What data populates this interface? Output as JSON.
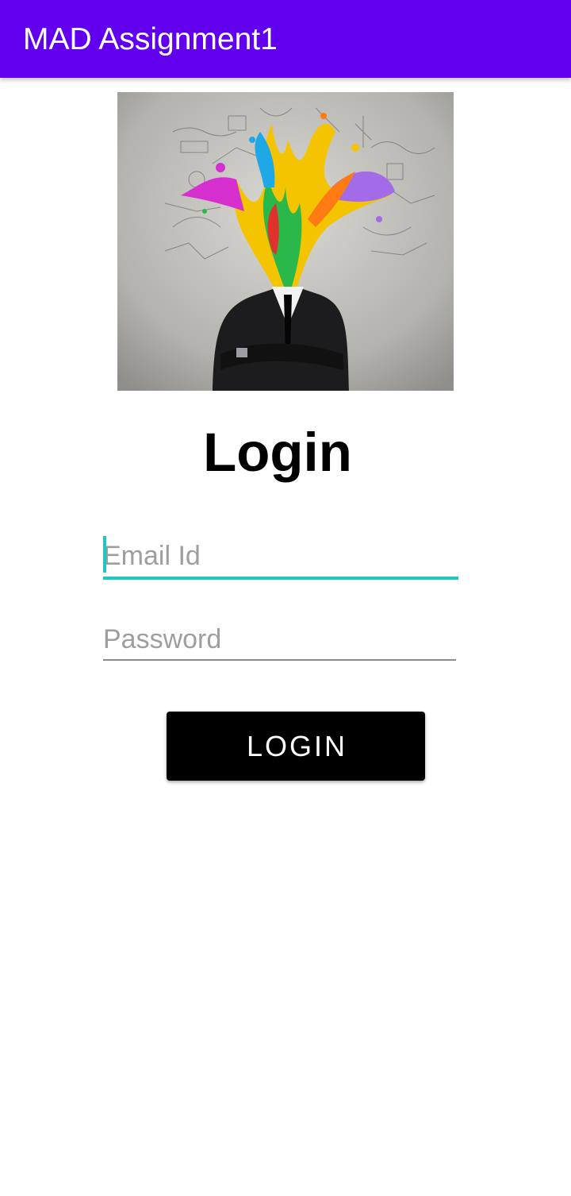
{
  "app_bar": {
    "title": "MAD Assignment1",
    "color": "#6200EE"
  },
  "hero_image": {
    "description_icon": "creative-businessman-image"
  },
  "heading": "Login",
  "form": {
    "email_placeholder": "Email Id",
    "password_placeholder": "Password",
    "focus_color": "#1FC7C0"
  },
  "login_button": {
    "label": "LOGIN",
    "color": "#000000"
  }
}
